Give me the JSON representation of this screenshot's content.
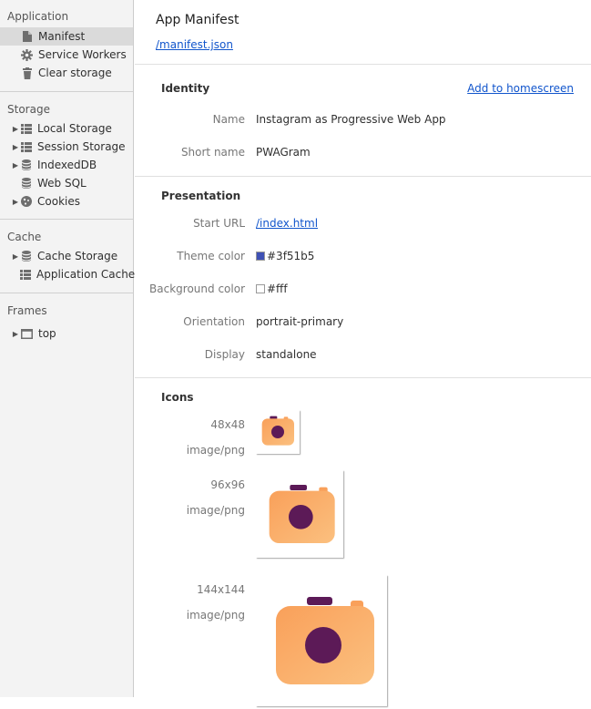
{
  "sidebar": {
    "application": {
      "header": "Application",
      "items": [
        {
          "label": "Manifest",
          "icon": "document-icon"
        },
        {
          "label": "Service Workers",
          "icon": "gear-icon"
        },
        {
          "label": "Clear storage",
          "icon": "trash-icon"
        }
      ]
    },
    "storage": {
      "header": "Storage",
      "items": [
        {
          "label": "Local Storage",
          "icon": "grid-icon"
        },
        {
          "label": "Session Storage",
          "icon": "grid-icon"
        },
        {
          "label": "IndexedDB",
          "icon": "database-icon"
        },
        {
          "label": "Web SQL",
          "icon": "database-icon"
        },
        {
          "label": "Cookies",
          "icon": "cookie-icon"
        }
      ]
    },
    "cache": {
      "header": "Cache",
      "items": [
        {
          "label": "Cache Storage",
          "icon": "database-icon"
        },
        {
          "label": "Application Cache",
          "icon": "grid-icon"
        }
      ]
    },
    "frames": {
      "header": "Frames",
      "items": [
        {
          "label": "top",
          "icon": "frame-icon"
        }
      ]
    }
  },
  "main": {
    "title": "App Manifest",
    "manifest_link": "/manifest.json",
    "identity": {
      "header": "Identity",
      "add_to_homescreen": "Add to homescreen",
      "name_label": "Name",
      "name_value": "Instagram as Progressive Web App",
      "short_name_label": "Short name",
      "short_name_value": "PWAGram"
    },
    "presentation": {
      "header": "Presentation",
      "start_url_label": "Start URL",
      "start_url_value": "/index.html",
      "theme_color_label": "Theme color",
      "theme_color_value": "#3f51b5",
      "background_color_label": "Background color",
      "background_color_value": "#fff",
      "orientation_label": "Orientation",
      "orientation_value": "portrait-primary",
      "display_label": "Display",
      "display_value": "standalone"
    },
    "icons": {
      "header": "Icons",
      "list": [
        {
          "size": "48x48",
          "type": "image/png"
        },
        {
          "size": "96x96",
          "type": "image/png"
        },
        {
          "size": "144x144",
          "type": "image/png"
        }
      ]
    }
  },
  "colors": {
    "link": "#1155cc",
    "camera_orange_top": "#f9a05a",
    "camera_orange_bottom": "#fbc07f",
    "camera_lens": "#5c1a57"
  }
}
